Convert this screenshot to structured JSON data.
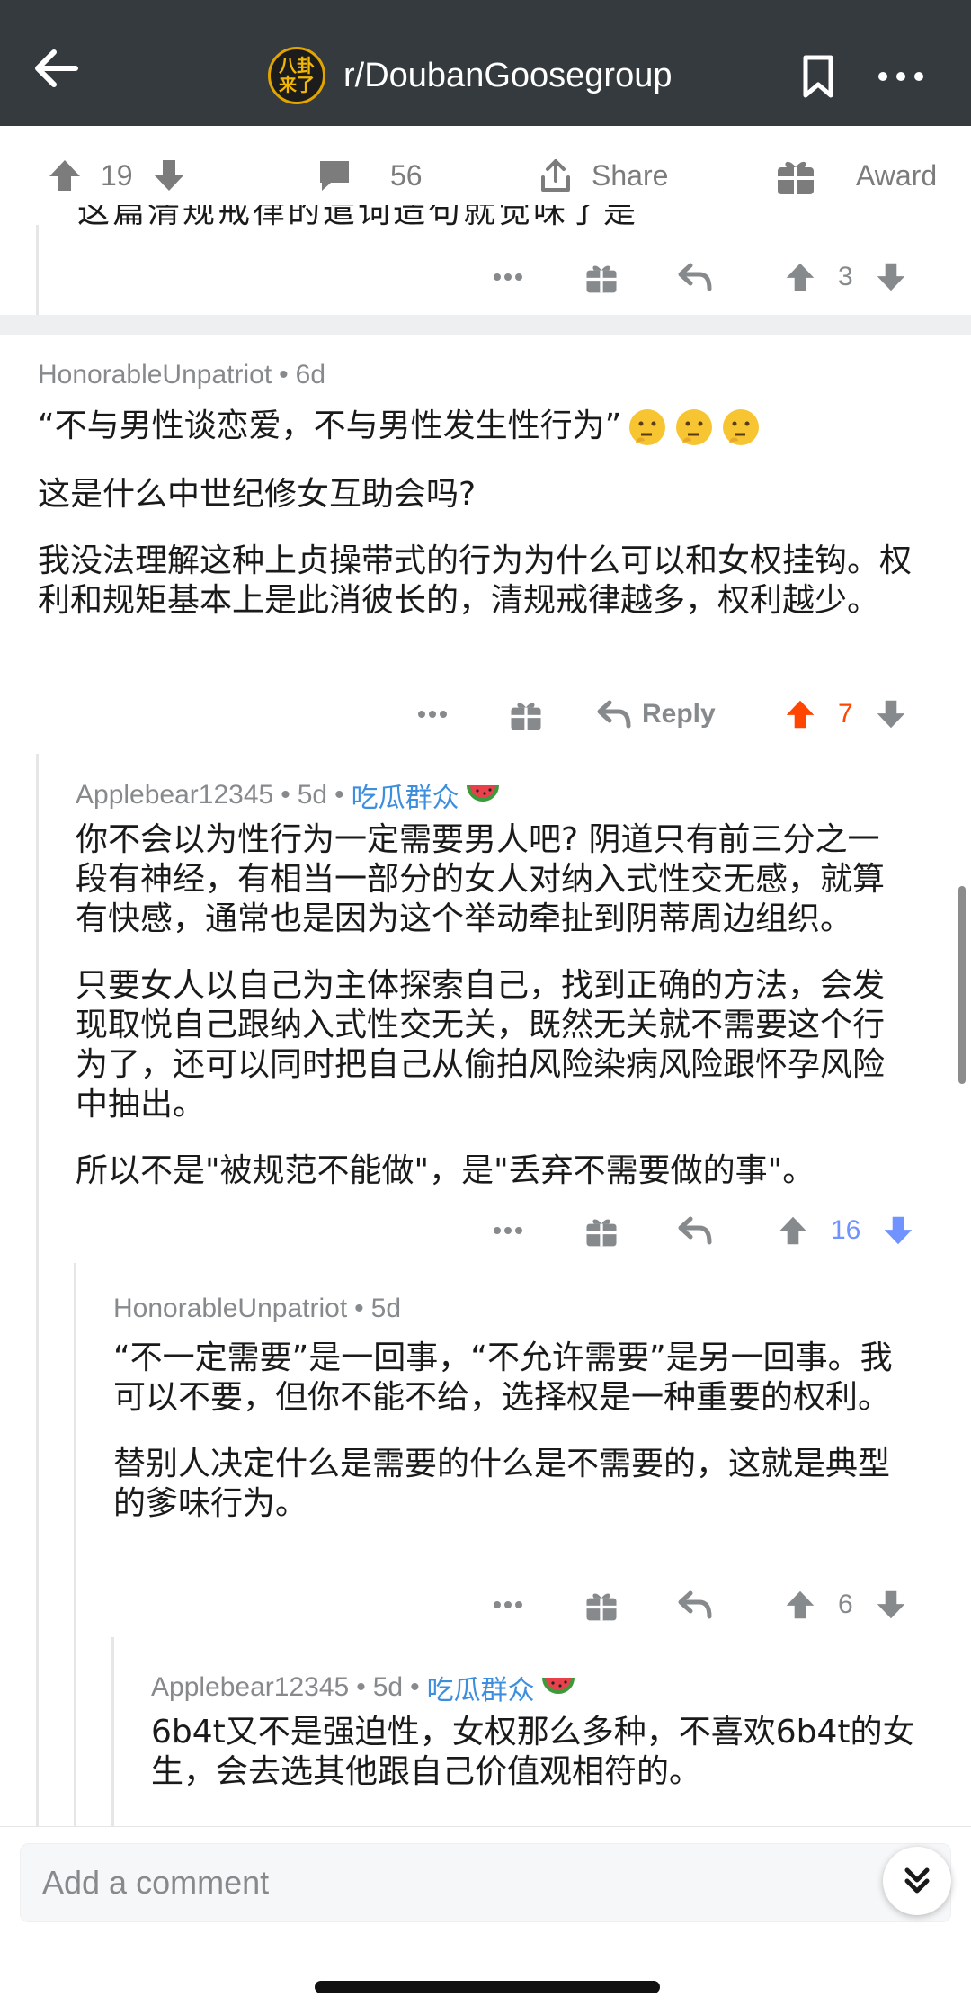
{
  "header": {
    "subreddit": "r/DoubanGoosegroup",
    "logo_text": "八卦来了"
  },
  "post_bar": {
    "upvotes": "19",
    "comments": "56",
    "share_label": "Share",
    "award_label": "Award"
  },
  "prev_comment": {
    "cut_text": "这篇清规戒律的遣词造句就觉味了是",
    "votes": "3"
  },
  "comments": [
    {
      "author": "HonorableUnpatriot",
      "age": "6d",
      "paragraphs": [
        "“不与男性谈恋爱，不与男性发生性行为”",
        "这是什么中世纪修女互助会吗?",
        "我没法理解这种上贞操带式的行为为什么可以和女权挂钩。权利和规矩基本上是此消彼长的，清规戒律越多，权利越少。"
      ],
      "reply_label": "Reply",
      "votes": "7"
    },
    {
      "author": "Applebear12345",
      "age": "5d",
      "flair": "吃瓜群众",
      "paragraphs": [
        "你不会以为性行为一定需要男人吧? 阴道只有前三分之一段有神经，有相当一部分的女人对纳入式性交无感，就算有快感，通常也是因为这个举动牵扯到阴蒂周边组织。",
        "只要女人以自己为主体探索自己，找到正确的方法，会发现取悦自己跟纳入式性交无关，既然无关就不需要这个行为了，还可以同时把自己从偷拍风险染病风险跟怀孕风险中抽出。",
        "所以不是\"被规范不能做\"，是\"丢弃不需要做的事\"。"
      ],
      "votes": "16"
    },
    {
      "author": "HonorableUnpatriot",
      "age": "5d",
      "paragraphs": [
        "“不一定需要”是一回事，“不允许需要”是另一回事。我可以不要，但你不能不给，选择权是一种重要的权利。",
        "替别人决定什么是需要的什么是不需要的，这就是典型的爹味行为。"
      ],
      "votes": "6"
    },
    {
      "author": "Applebear12345",
      "age": "5d",
      "flair": "吃瓜群众",
      "paragraphs": [
        "6b4t又不是强迫性，女权那么多种，不喜欢6b4t的女生，会去选其他跟自己价值观相符的。"
      ]
    }
  ],
  "comment_input": {
    "placeholder": "Add a comment"
  },
  "colors": {
    "header_bg": "#353a3e",
    "upvote_orange": "#ff4500",
    "downvote_blue": "#7193ff",
    "flair_blue": "#3e8ede"
  }
}
